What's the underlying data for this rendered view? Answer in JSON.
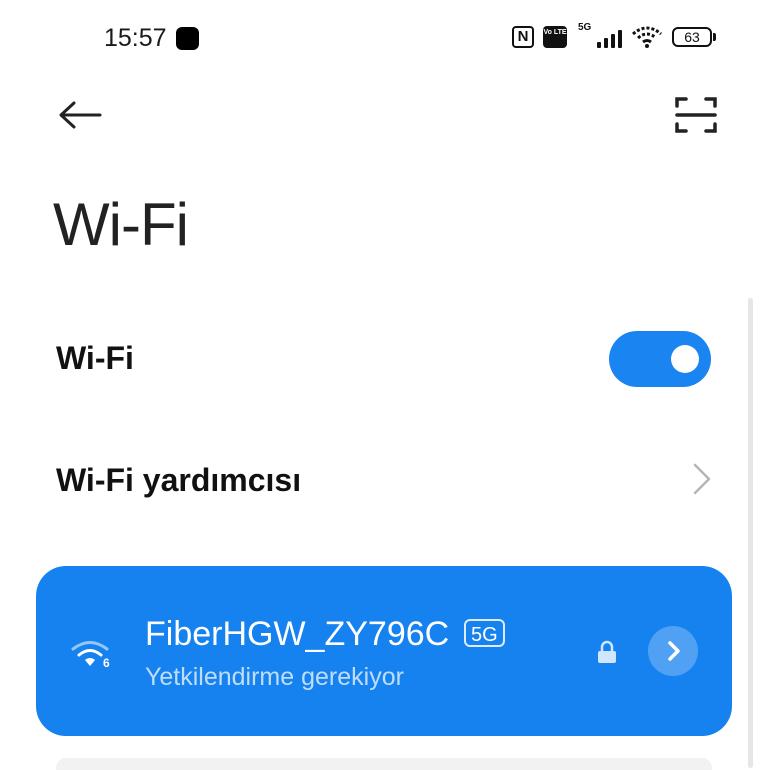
{
  "status_bar": {
    "time": "15:57",
    "nfc_label": "N",
    "volte_label": "Vo LTE",
    "network_label": "5G",
    "battery": "63",
    "icons": [
      "nfc-icon",
      "volte-icon",
      "signal-icon",
      "wifi-icon",
      "battery-icon"
    ]
  },
  "header": {
    "title": "Wi-Fi",
    "icons": [
      "back-arrow-icon",
      "scan-icon"
    ]
  },
  "settings": {
    "wifi_toggle_label": "Wi-Fi",
    "wifi_enabled": true,
    "assistant_label": "Wi-Fi yardımcısı"
  },
  "network": {
    "ssid": "FiberHGW_ZY796C",
    "band_badge": "5G",
    "status": "Yetkilendirme gerekiyor",
    "wifi_standard": "6",
    "secured": true
  },
  "colors": {
    "accent": "#1a84f0",
    "card": "#1682f0"
  }
}
